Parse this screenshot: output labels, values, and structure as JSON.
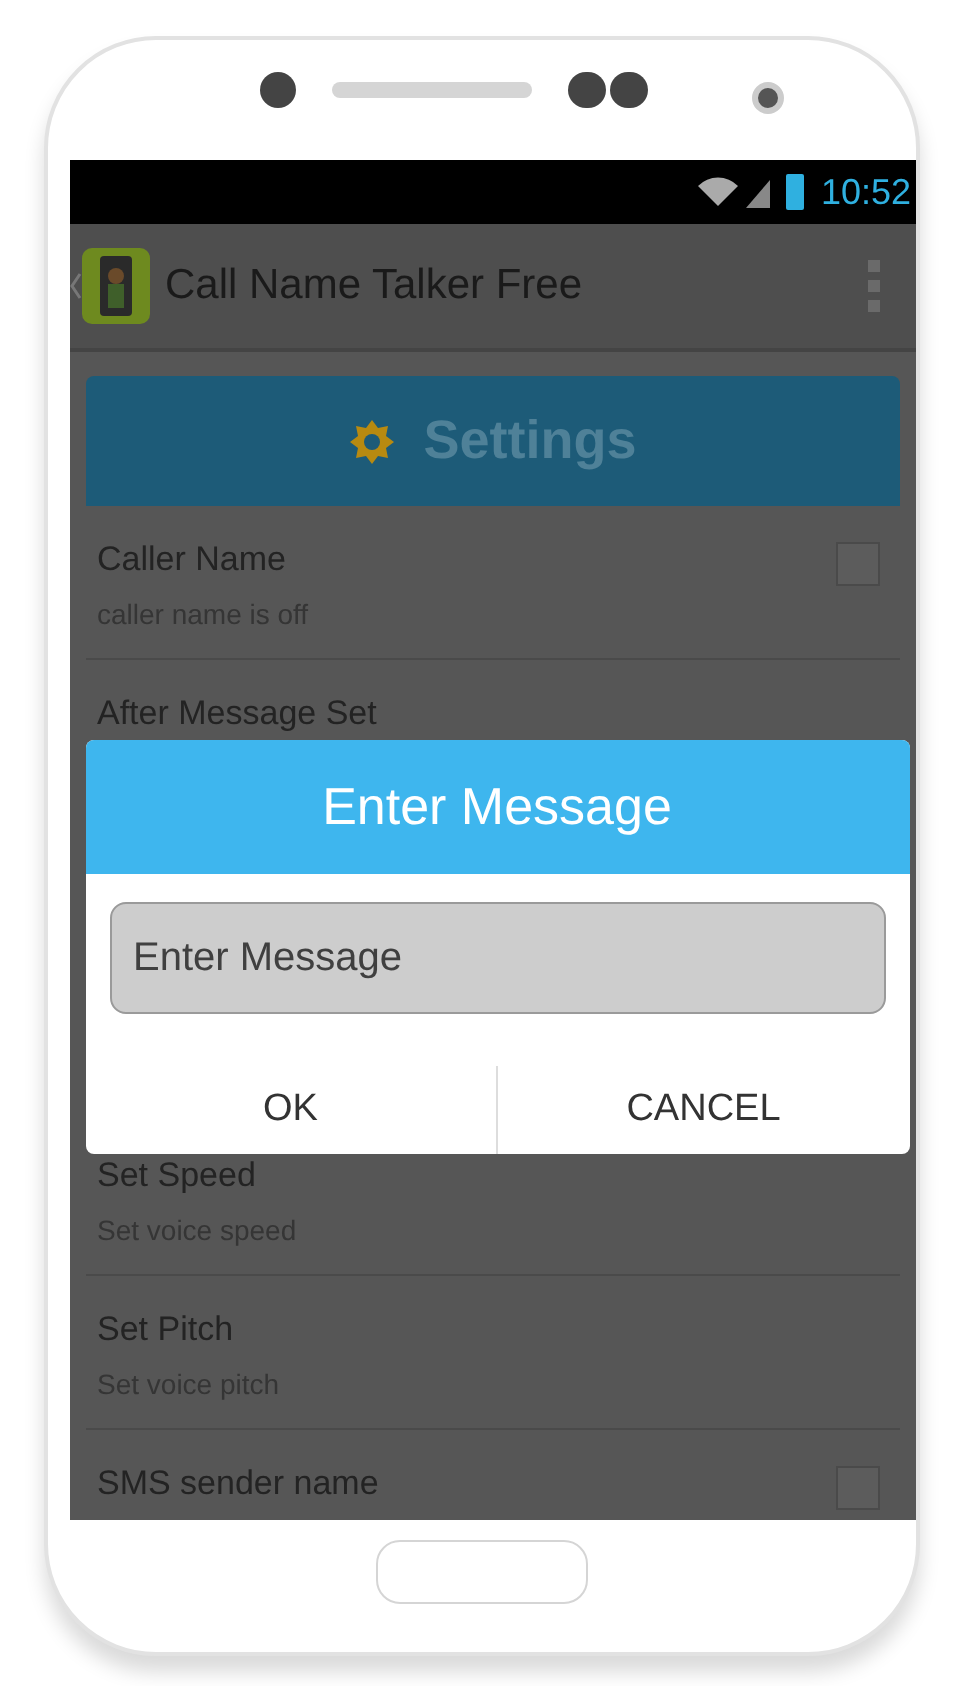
{
  "status_bar": {
    "time": "10:52"
  },
  "action_bar": {
    "title": "Call Name Talker Free"
  },
  "header": {
    "title": "Settings"
  },
  "settings_top": [
    {
      "title": "Caller Name",
      "subtitle": "caller name is off",
      "kind": "checkbox",
      "checked": false
    },
    {
      "title": "After Message Set",
      "kind": "plain"
    }
  ],
  "settings_bottom": [
    {
      "title": "Set Speed",
      "subtitle": "Set voice speed",
      "kind": "plain"
    },
    {
      "title": "Set Pitch",
      "subtitle": "Set voice pitch",
      "kind": "plain"
    },
    {
      "title": "SMS sender name",
      "kind": "checkbox",
      "checked": false
    }
  ],
  "dialog": {
    "title": "Enter Message",
    "field": {
      "placeholder": "Enter Message"
    },
    "buttons": [
      "OK",
      "CANCEL"
    ]
  }
}
